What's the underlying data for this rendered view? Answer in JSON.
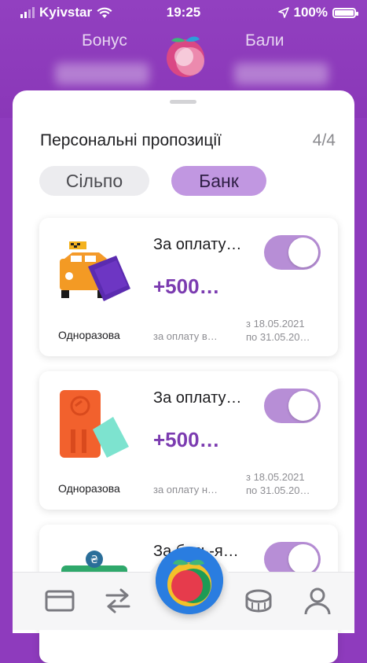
{
  "status_bar": {
    "carrier": "Kyivstar",
    "time": "19:25",
    "battery": "100%",
    "battery_level": 1.0
  },
  "header": {
    "bonus_label": "Бонус",
    "points_label": "Бали"
  },
  "offers": {
    "title": "Персональні пропозиції",
    "counter": "4/4",
    "tabs": [
      "Сільпо",
      "Банк"
    ],
    "active_tab": "Банк",
    "cards": [
      {
        "title": "За оплату…",
        "amount": "+500…",
        "toggle_on": true,
        "kind": "Одноразова",
        "description": "за оплату в…",
        "date_from": "з 18.05.2021",
        "date_to": "по 31.05.20…"
      },
      {
        "title": "За оплату…",
        "amount": "+500…",
        "toggle_on": true,
        "kind": "Одноразова",
        "description": "за оплату н…",
        "date_from": "з 18.05.2021",
        "date_to": "по 31.05.20…"
      },
      {
        "title": "За будь-я…",
        "amount": "",
        "toggle_on": true,
        "kind": "",
        "description": "",
        "date_from": "",
        "date_to": ""
      }
    ]
  },
  "tab_bar": {
    "items": [
      "card-icon",
      "transfer-icon",
      "fruit-logo-icon",
      "coins-icon",
      "profile-icon"
    ]
  },
  "colors": {
    "brand_purple": "#8a37b8",
    "amount_purple": "#7b3bb0",
    "toggle_on": "#b78ed6",
    "chip_active": "#c197e1"
  }
}
